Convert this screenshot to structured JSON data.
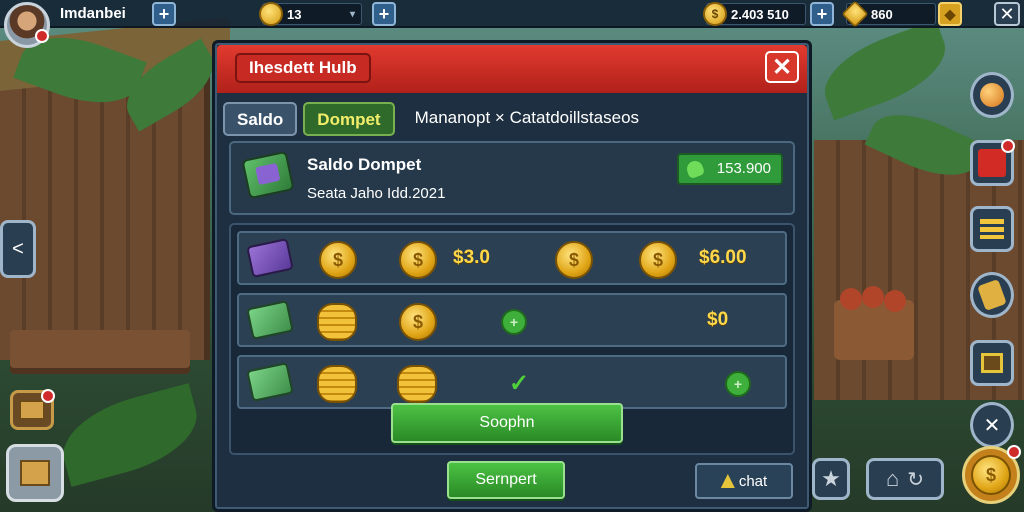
{
  "topbar": {
    "player_name": "Imdanbei",
    "resource1_value": "13",
    "resource1_suffix": "▾",
    "gold_value": "2.403 510",
    "gold_icon": "$",
    "gem_value": "860",
    "plus_label": "+",
    "close_label": "✕"
  },
  "modal": {
    "title": "Ihesdett Hulb",
    "close_label": "✕",
    "tabs": [
      "Saldo",
      "Dompet"
    ],
    "tab_extra": "Mananopt × Catatdoillstaseos",
    "balance_title": "Saldo Dompet",
    "balance_sub": "Seata Jaho Idd.2021",
    "balance_amount": "153.900",
    "rows": [
      {
        "coin_symbol": "$",
        "value1": "$3.0",
        "value2": "$6.00"
      },
      {
        "coin_symbol": "$",
        "green_icon": "+",
        "value2": "$0"
      },
      {
        "coin_symbol": "$",
        "check": "✓",
        "green_icon": "+"
      }
    ],
    "primary_button": "Soophn",
    "secondary_button": "Sernpert",
    "chat_button": "chat"
  },
  "side": {
    "left_arrow": "<",
    "close_label": "✕",
    "star": "★",
    "home": "⌂",
    "refresh": "↻",
    "coin_symbol": "$"
  },
  "colors": {
    "header_red": "#d3312a",
    "button_green": "#3fb03b",
    "panel_dark": "#1d2f40",
    "gold": "#f2c23a"
  }
}
